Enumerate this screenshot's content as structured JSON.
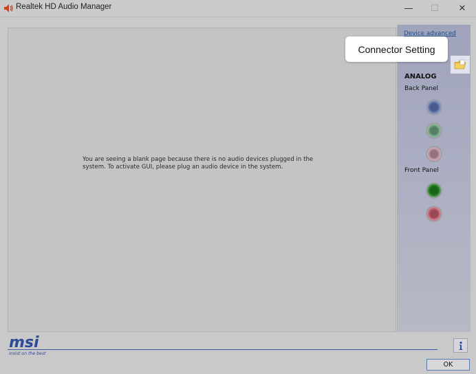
{
  "window": {
    "title": "Realtek HD Audio Manager",
    "icon": "speaker-icon",
    "controls": {
      "minimize": "—",
      "maximize": "☐",
      "close": "✕"
    }
  },
  "main": {
    "message_line1": "You are seeing a blank page because there is no audio devices plugged in the",
    "message_line2": "system. To activate GUI, please plug an audio device in the system."
  },
  "sidebar": {
    "device_advanced_label": "Device advanced",
    "folder_icon": "folder-icon",
    "tooltip": "Connector Setting",
    "section_title": "ANALOG",
    "back_panel_label": "Back Panel",
    "front_panel_label": "Front Panel",
    "back_jacks": [
      {
        "name": "line-in",
        "color": "#5b6fa8"
      },
      {
        "name": "line-out",
        "color": "#6b9a78"
      },
      {
        "name": "mic-in",
        "color": "#b48c98"
      }
    ],
    "front_jacks": [
      {
        "name": "headphone",
        "color": "#1e7a1e"
      },
      {
        "name": "mic",
        "color": "#b85a66"
      }
    ]
  },
  "footer": {
    "brand": "msi",
    "tagline": "Insist on the best",
    "info_icon": "info-icon",
    "ok_label": "OK"
  },
  "colors": {
    "brand_blue": "#2c4a96",
    "link_blue": "#1c4e8a"
  }
}
